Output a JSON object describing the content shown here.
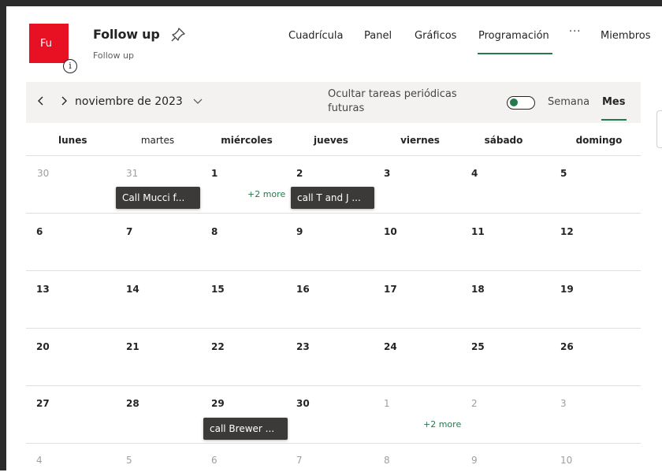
{
  "plan": {
    "avatar_initials": "Fu",
    "title": "Follow up",
    "subtitle": "Follow up",
    "avatar_color": "#e81123"
  },
  "nav": {
    "tabs": [
      "Cuadrícula",
      "Panel",
      "Gráficos",
      "Programación",
      "Miembros"
    ],
    "active_tab": "Programación",
    "more": "···"
  },
  "toolbar": {
    "month_label": "noviembre de 2023",
    "hide_label": "Ocultar tareas periódicas futuras",
    "hide_recurring_enabled": true,
    "views": [
      "Semana",
      "Mes"
    ],
    "active_view": "Mes",
    "accent_color": "#237b4b"
  },
  "calendar": {
    "weekdays": [
      "lunes",
      "martes",
      "miércoles",
      "jueves",
      "viernes",
      "sábado",
      "domingo"
    ],
    "weeks": [
      [
        "30",
        "31",
        "1",
        "2",
        "3",
        "4",
        "5"
      ],
      [
        "6",
        "7",
        "8",
        "9",
        "10",
        "11",
        "12"
      ],
      [
        "13",
        "14",
        "15",
        "16",
        "17",
        "18",
        "19"
      ],
      [
        "20",
        "21",
        "22",
        "23",
        "24",
        "25",
        "26"
      ],
      [
        "27",
        "28",
        "29",
        "30",
        "1",
        "2",
        "3"
      ],
      [
        "4",
        "5",
        "6",
        "7",
        "8",
        "9",
        "10"
      ]
    ],
    "tasks": [
      {
        "label": "Call Mucci f..."
      },
      {
        "label": "call T and J ..."
      },
      {
        "label": "call Brewer ..."
      }
    ],
    "more_labels": [
      "+2 more",
      "+2 more"
    ]
  }
}
